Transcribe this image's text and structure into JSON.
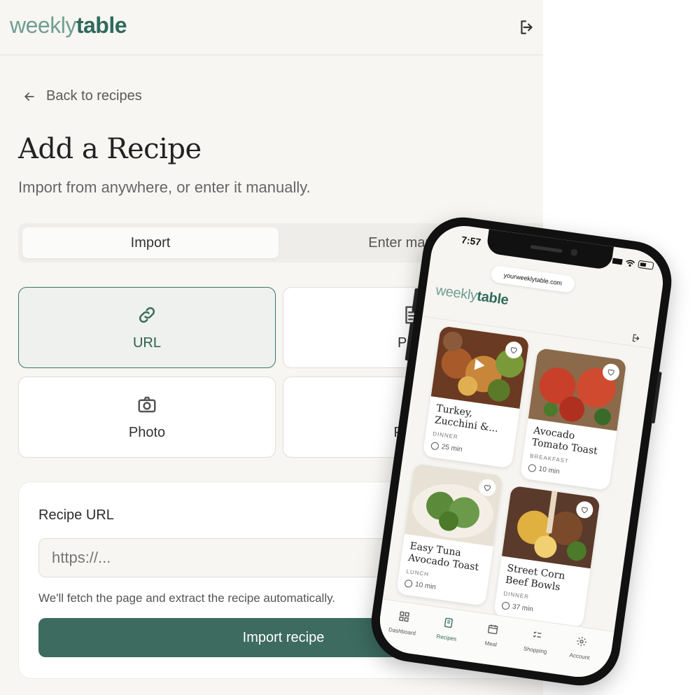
{
  "brand": {
    "logo_light": "weekly",
    "logo_bold": "table",
    "accent": "#3d6b5f"
  },
  "header": {
    "logout_icon": "logout-icon"
  },
  "nav": {
    "back_label": "Back to recipes"
  },
  "page": {
    "title": "Add a Recipe",
    "subtitle": "Import from anywhere, or enter it manually."
  },
  "tabs": [
    {
      "label": "Import",
      "active": true
    },
    {
      "label": "Enter manually",
      "active": false
    }
  ],
  "options": [
    {
      "label": "URL",
      "icon": "link-icon",
      "selected": true
    },
    {
      "label": "PDF",
      "icon": "document-icon",
      "selected": false
    },
    {
      "label": "Photo",
      "icon": "camera-icon",
      "selected": false
    },
    {
      "label": "Paste",
      "icon": "clipboard-icon",
      "selected": false
    }
  ],
  "url_form": {
    "label": "Recipe URL",
    "placeholder": "https://...",
    "help": "We'll fetch the page and extract the recipe automatically.",
    "submit_label": "Import recipe"
  },
  "phone": {
    "time": "7:57",
    "address": "yourweeklytable.com",
    "logo_light": "weekly",
    "logo_bold": "table",
    "recipes": [
      {
        "title": "Turkey, Zucchini &...",
        "meal": "DINNER",
        "time": "25 min"
      },
      {
        "title": "Avocado Tomato Toast",
        "meal": "BREAKFAST",
        "time": "10 min"
      },
      {
        "title": "Easy Tuna Avocado Toast",
        "meal": "LUNCH",
        "time": "10 min"
      },
      {
        "title": "Street Corn Beef Bowls",
        "meal": "DINNER",
        "time": "37 min"
      }
    ],
    "nav": [
      {
        "label": "Dashboard",
        "icon": "grid-icon"
      },
      {
        "label": "Recipes",
        "icon": "recipe-book-icon",
        "active": true
      },
      {
        "label": "Meal",
        "icon": "calendar-icon"
      },
      {
        "label": "Shopping",
        "icon": "checklist-icon"
      },
      {
        "label": "Account",
        "icon": "gear-icon"
      }
    ]
  }
}
